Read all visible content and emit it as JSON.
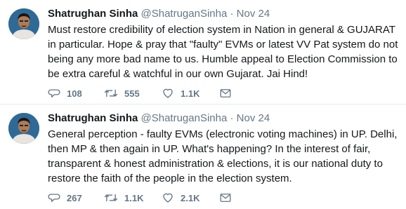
{
  "tweets": [
    {
      "name": "Shatrughan Sinha",
      "handle": "@ShatruganSinha",
      "separator": "·",
      "date": "Nov 24",
      "text": "Must restore credibility of election system in Nation in general & GUJARAT in particular. Hope & pray that \"faulty\" EVMs or latest VV Pat system do not being any more bad name to us. Humble appeal to Election Commission to be extra careful & watchful in our own Gujarat. Jai Hind!",
      "replies": "108",
      "retweets": "555",
      "likes": "1.1K"
    },
    {
      "name": "Shatrughan Sinha",
      "handle": "@ShatruganSinha",
      "separator": "·",
      "date": "Nov 24",
      "text": "General perception - faulty EVMs (electronic voting machines) in UP. Delhi, then MP & then again in UP. What's happening? In the interest of fair, transparent & honest administration & elections, it is our national duty to restore the faith of the people in the election system.",
      "replies": "267",
      "retweets": "1.1K",
      "likes": "2.1K"
    }
  ],
  "icons": {
    "reply": "reply-icon",
    "retweet": "retweet-icon",
    "like": "heart-icon",
    "dm": "envelope-icon"
  },
  "colors": {
    "text": "#14171a",
    "secondary": "#657786",
    "divider": "#e6ecf0"
  }
}
